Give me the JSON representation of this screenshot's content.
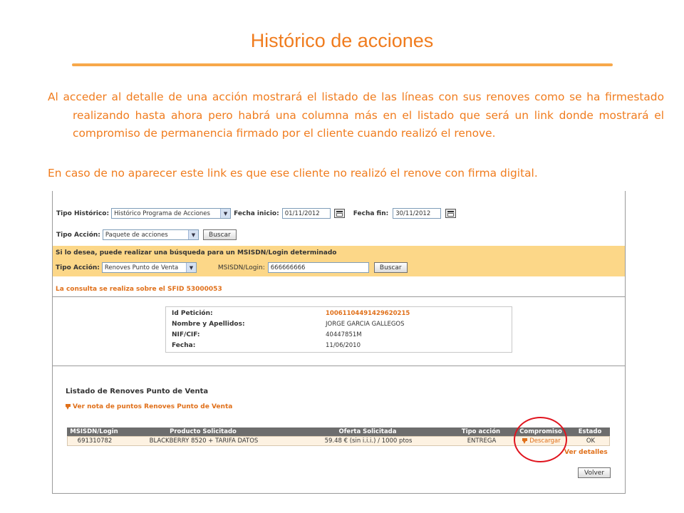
{
  "slide": {
    "title": "Histórico de acciones",
    "paragraph1": "Al acceder al detalle de una acción mostrará el listado de las líneas con sus renoves como se ha firmestado realizando hasta ahora pero habrá una columna más en el listado que será un link donde mostrará el compromiso de permanencia firmado por el cliente cuando realizó el renove.",
    "paragraph2": "En caso de no aparecer este link es que ese cliente no realizó el renove con firma digital.",
    "accent_color": "#f07c1e"
  },
  "filters": {
    "tipo_historico_label": "Tipo Histórico:",
    "tipo_historico_value": "Histórico Programa de Acciones",
    "fecha_inicio_label": "Fecha inicio:",
    "fecha_inicio_value": "01/11/2012",
    "fecha_fin_label": "Fecha fin:",
    "fecha_fin_value": "30/11/2012",
    "tipo_accion_label": "Tipo Acción:",
    "tipo_accion_value": "Paquete de acciones",
    "buscar_label": "Buscar"
  },
  "search_band": {
    "heading": "Si lo desea, puede realizar una búsqueda para un MSISDN/Login determinado",
    "tipo_accion_label": "Tipo Acción:",
    "tipo_accion_value": "Renoves Punto de Venta",
    "msisdn_label": "MSISDN/Login:",
    "msisdn_value": "666666666",
    "buscar_label": "Buscar"
  },
  "sfid_notice": "La consulta se realiza sobre el SFID 53000053",
  "detail": {
    "id_label": "Id Petición:",
    "id_value": "10061104491429620215",
    "nombre_label": "Nombre y Apellidos:",
    "nombre_value": "JORGE GARCIA GALLEGOS",
    "nif_label": "NIF/CIF:",
    "nif_value": "40447851M",
    "fecha_label": "Fecha:",
    "fecha_value": "11/06/2010"
  },
  "listado": {
    "title": "Listado de Renoves Punto de Venta",
    "nota_link": "Ver nota de puntos Renoves Punto de Venta",
    "columns": [
      "MSISDN/Login",
      "Producto Solicitado",
      "Oferta Solicitada",
      "Tipo acción",
      "Compromiso",
      "Estado"
    ],
    "rows": [
      [
        "691310782",
        "BLACKBERRY 8520 + TARIFA DATOS",
        "59.48 € (sin i.i.i.) / 1000 ptos",
        "ENTREGA",
        "Descargar",
        "OK"
      ]
    ],
    "ver_detalles": "Ver detalles",
    "volver_label": "Volver"
  }
}
